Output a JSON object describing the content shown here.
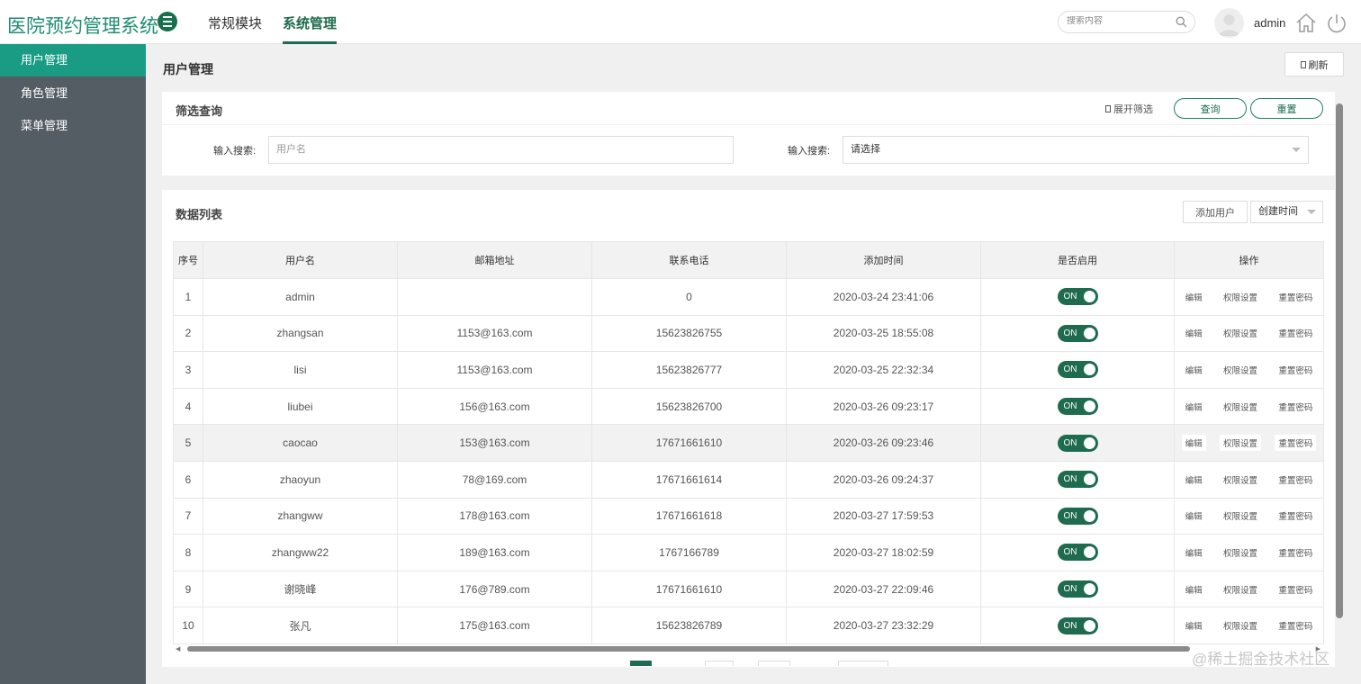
{
  "header": {
    "app_title": "医院预约管理系统",
    "nav_tabs": [
      {
        "label": "常规模块"
      },
      {
        "label": "系统管理"
      }
    ],
    "search_placeholder": "搜索内容",
    "username": "admin"
  },
  "sidebar": {
    "items": [
      {
        "label": "用户管理"
      },
      {
        "label": "角色管理"
      },
      {
        "label": "菜单管理"
      }
    ]
  },
  "page": {
    "title": "用户管理",
    "refresh_label": "刷新"
  },
  "filter": {
    "title": "筛选查询",
    "expand_label": "展开筛选",
    "query_label": "查询",
    "reset_label": "重置",
    "label1": "输入搜索:",
    "input1_placeholder": "用户名",
    "label2": "输入搜索:",
    "select2_value": "请选择"
  },
  "data_list": {
    "title": "数据列表",
    "add_label": "添加用户",
    "sort_value": "创建时间",
    "columns": [
      "序号",
      "用户名",
      "邮箱地址",
      "联系电话",
      "添加时间",
      "是否启用",
      "操作"
    ],
    "toggle_label": "ON",
    "ops": [
      "编辑",
      "权限设置",
      "重置密码"
    ],
    "rows": [
      {
        "idx": "1",
        "user": "admin",
        "email": "",
        "phone": "0",
        "time": "2020-03-24 23:41:06"
      },
      {
        "idx": "2",
        "user": "zhangsan",
        "email": "1153@163.com",
        "phone": "15623826755",
        "time": "2020-03-25 18:55:08"
      },
      {
        "idx": "3",
        "user": "lisi",
        "email": "1153@163.com",
        "phone": "15623826777",
        "time": "2020-03-25 22:32:34"
      },
      {
        "idx": "4",
        "user": "liubei",
        "email": "156@163.com",
        "phone": "15623826700",
        "time": "2020-03-26 09:23:17"
      },
      {
        "idx": "5",
        "user": "caocao",
        "email": "153@163.com",
        "phone": "17671661610",
        "time": "2020-03-26 09:23:46"
      },
      {
        "idx": "6",
        "user": "zhaoyun",
        "email": "78@169.com",
        "phone": "17671661614",
        "time": "2020-03-26 09:24:37"
      },
      {
        "idx": "7",
        "user": "zhangww",
        "email": "178@163.com",
        "phone": "17671661618",
        "time": "2020-03-27 17:59:53"
      },
      {
        "idx": "8",
        "user": "zhangww22",
        "email": "189@163.com",
        "phone": "1767166789",
        "time": "2020-03-27 18:02:59"
      },
      {
        "idx": "9",
        "user": "谢晓峰",
        "email": "176@789.com",
        "phone": "17671661610",
        "time": "2020-03-27 22:09:46"
      },
      {
        "idx": "10",
        "user": "张凡",
        "email": "175@163.com",
        "phone": "15623826789",
        "time": "2020-03-27 23:32:29"
      }
    ]
  },
  "watermark": "@稀土掘金技术社区",
  "colors": {
    "brand": "#1e6b4f",
    "sidebar_bg": "#545c64",
    "sidebar_active": "#1a9c84"
  }
}
